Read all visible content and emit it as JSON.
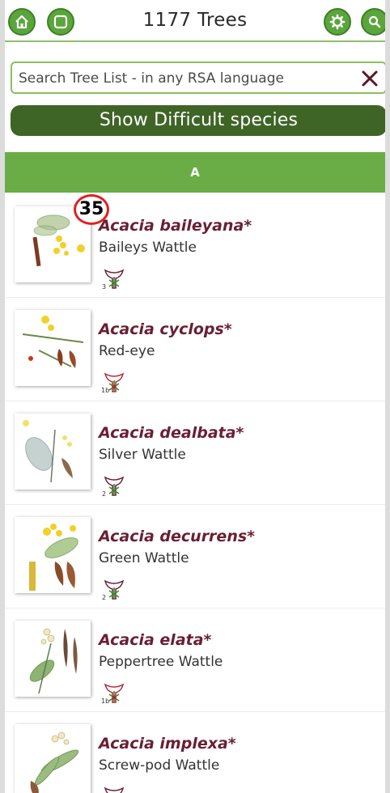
{
  "header": {
    "title": "1177 Trees",
    "home_icon": "home-icon",
    "square_icon": "square-icon",
    "settings_icon": "gear-icon",
    "search_icon": "search-icon"
  },
  "search": {
    "placeholder": "Search Tree List - in any RSA language",
    "value": "",
    "clear_icon": "close-icon"
  },
  "difficult_button": {
    "label": "Show Difficult species"
  },
  "section": {
    "label": "A"
  },
  "badge": {
    "value": "35"
  },
  "trees": [
    {
      "scientific": "Acacia baileyana*",
      "common": "Baileys Wattle",
      "flower_code": "3"
    },
    {
      "scientific": "Acacia cyclops*",
      "common": "Red-eye",
      "flower_code": "1b"
    },
    {
      "scientific": "Acacia dealbata*",
      "common": "Silver Wattle",
      "flower_code": "2"
    },
    {
      "scientific": "Acacia decurrens*",
      "common": "Green Wattle",
      "flower_code": "2"
    },
    {
      "scientific": "Acacia elata*",
      "common": "Peppertree Wattle",
      "flower_code": "1b"
    },
    {
      "scientific": "Acacia implexa*",
      "common": "Screw-pod Wattle",
      "flower_code": ""
    }
  ],
  "colors": {
    "accent": "#6aad46",
    "dark_green": "#3f6526",
    "species_text": "#6a1f33",
    "badge_ring": "#e02020"
  }
}
